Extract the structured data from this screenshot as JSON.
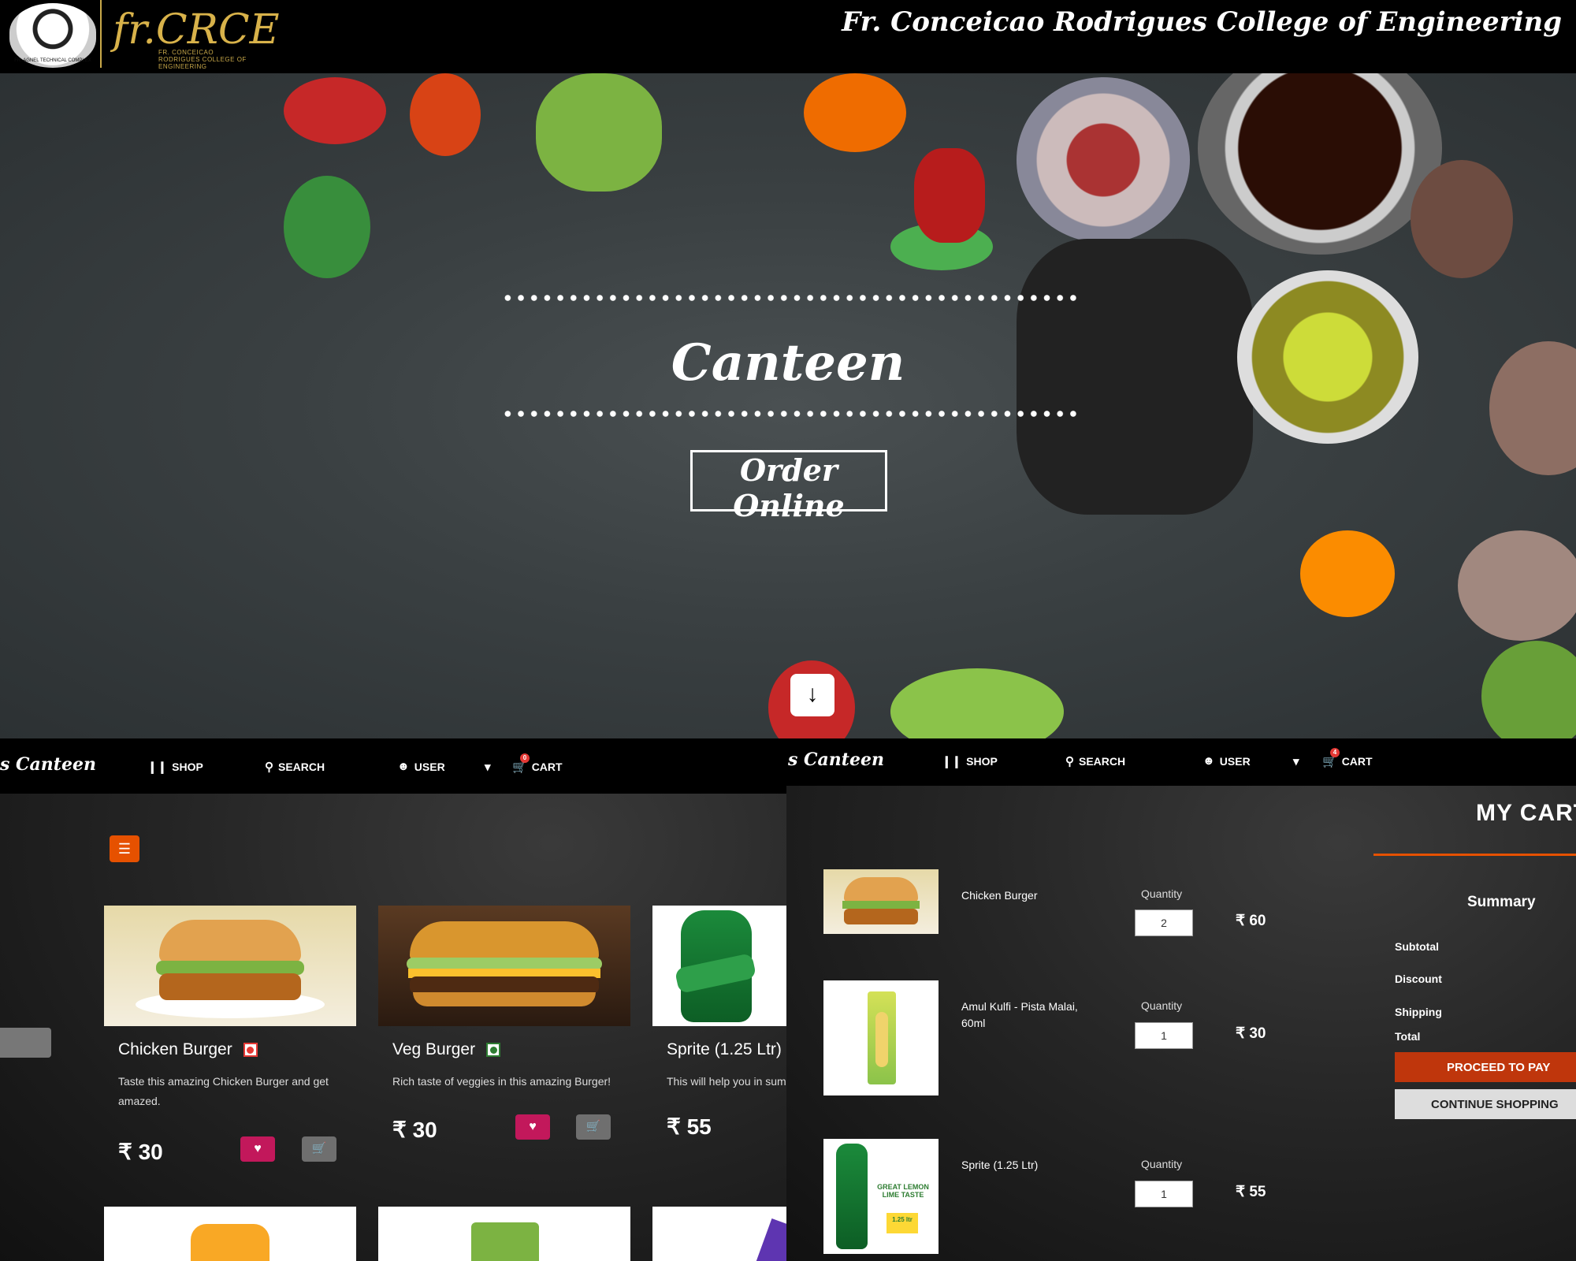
{
  "header": {
    "college_name": "Fr. Conceicao Rodrigues College of Engineering",
    "brand_logo_text": "fr.CRCE",
    "brand_logo_subtext": "FR. CONCEICAO RODRIGUES COLLEGE OF ENGINEERING",
    "seal_text": "FR. AGNEL TECHNICAL COMPLEX"
  },
  "hero": {
    "title": "Canteen",
    "order_button": "Order Online",
    "scroll_icon": "arrow-down-icon"
  },
  "shop_panel": {
    "nav": {
      "brand": "s Canteen",
      "shop": "SHOP",
      "search": "SEARCH",
      "user": "USER",
      "cart": "CART",
      "cart_badge": "0"
    },
    "products": [
      {
        "name": "Chicken Burger",
        "type": "non-veg",
        "description": "Taste this amazing Chicken Burger and get amazed.",
        "price": "₹ 30"
      },
      {
        "name": "Veg Burger",
        "type": "veg",
        "description": "Rich taste of veggies in this amazing Burger!",
        "price": "₹ 30"
      },
      {
        "name": "Sprite (1.25 Ltr)",
        "type": "none",
        "description": "This will help you in sum",
        "price": "₹ 55"
      }
    ]
  },
  "cart_panel": {
    "nav": {
      "brand": "s Canteen",
      "shop": "SHOP",
      "search": "SEARCH",
      "user": "USER",
      "cart": "CART",
      "cart_badge": "4"
    },
    "title": "MY CART",
    "quantity_label": "Quantity",
    "items": [
      {
        "name": "Chicken Burger",
        "quantity": "2",
        "total": "₹ 60"
      },
      {
        "name": "Amul Kulfi - Pista Malai, 60ml",
        "quantity": "1",
        "total": "₹ 30"
      },
      {
        "name": "Sprite (1.25 Ltr)",
        "quantity": "1",
        "total": "₹ 55"
      }
    ],
    "summary": {
      "title": "Summary",
      "subtotal": "Subtotal",
      "discount": "Discount",
      "shipping": "Shipping",
      "total": "Total",
      "proceed": "PROCEED TO PAY",
      "continue": "CONTINUE SHOPPING"
    },
    "sprite_label": "GREAT LEMON LIME TASTE",
    "sprite_volume": "1.25 ltr"
  },
  "colors": {
    "accent": "#e65100",
    "favorite": "#c2185b",
    "nonveg": "#e53935",
    "veg": "#2e7d32"
  }
}
